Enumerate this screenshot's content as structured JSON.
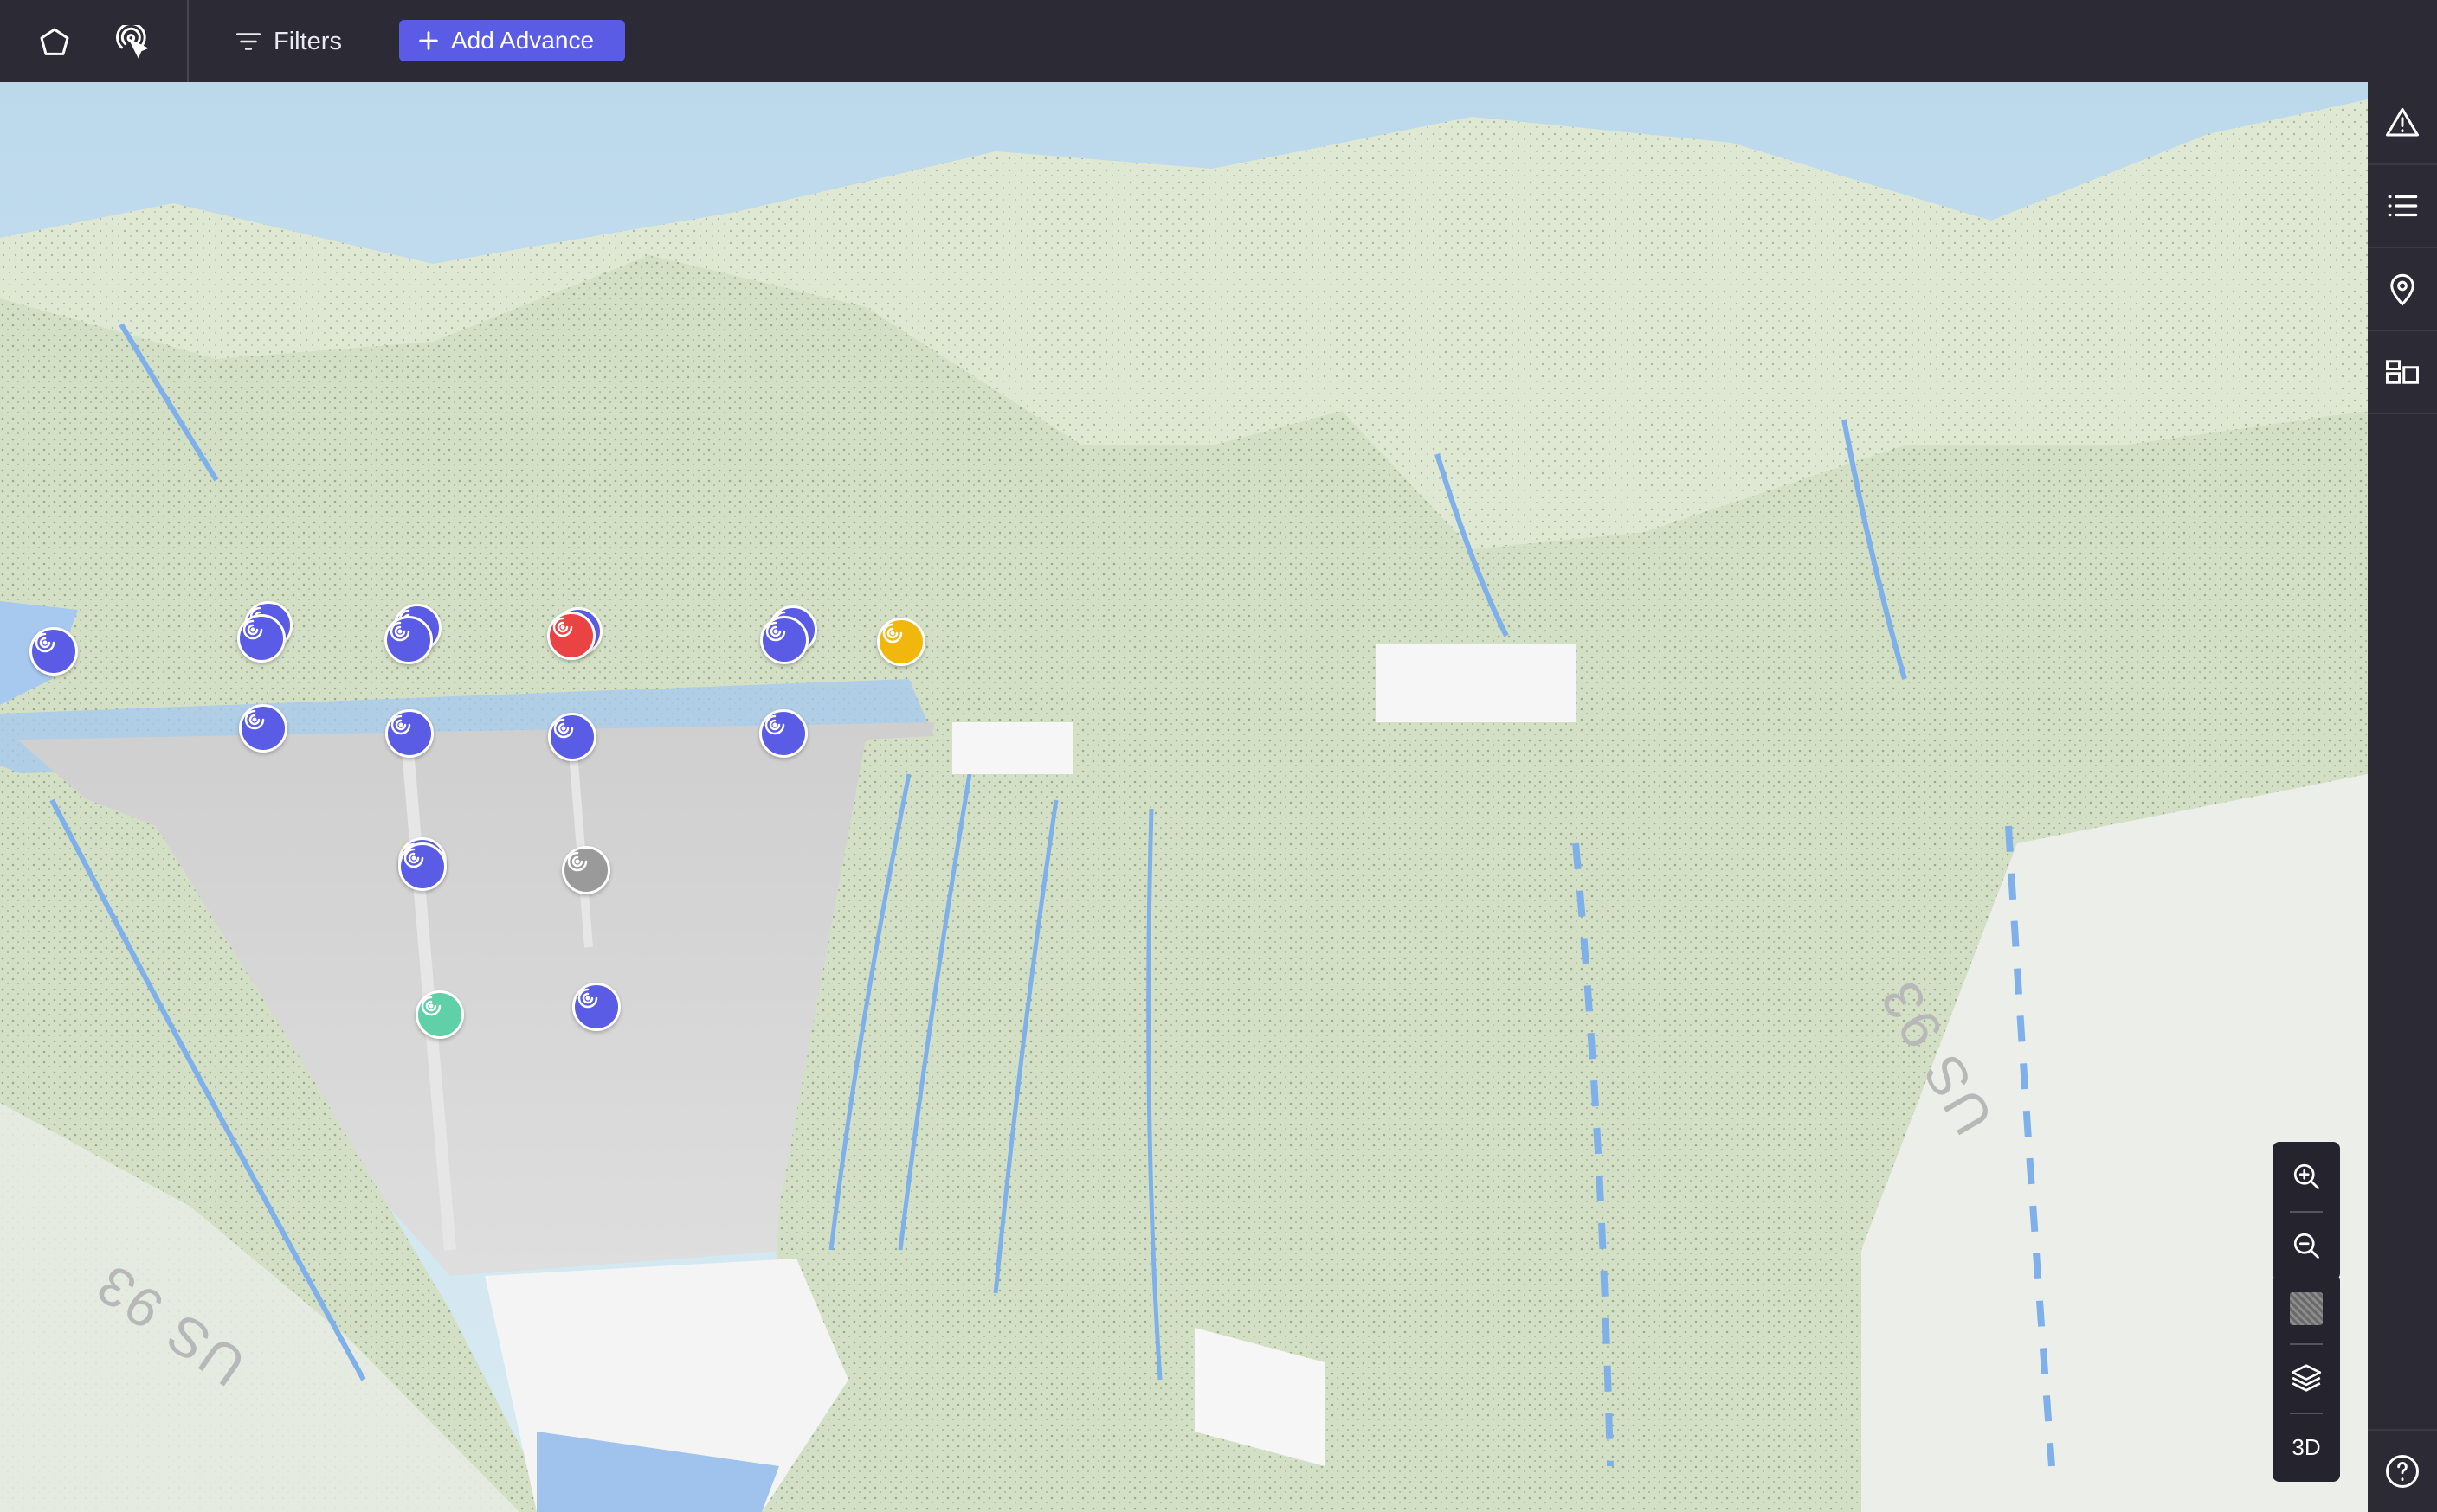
{
  "toolbar": {
    "polygon_tool": "polygon-tool",
    "pointer_tool": "pointer-tool",
    "filters_label": "Filters",
    "add_label": "Add Advance"
  },
  "rail": {
    "items": [
      "alert-icon",
      "list-icon",
      "location-pin-icon",
      "layout-icon"
    ],
    "help": "help-icon"
  },
  "controls": {
    "zoom_in": "zoom-in-icon",
    "zoom_out": "zoom-out-icon",
    "basemap": "basemap-thumbnail",
    "layers": "layers-icon",
    "mode_label": "3D"
  },
  "map": {
    "road_labels": [
      "US 93",
      "US 93"
    ],
    "marker_colors": {
      "default": "#5b5ce6",
      "alert": "#e94343",
      "warning": "#f2b70c",
      "inactive": "#9a9a9a",
      "ok": "#5fd0a8"
    },
    "markers": [
      {
        "status": "default"
      },
      {
        "status": "default"
      },
      {
        "status": "default"
      },
      {
        "status": "default"
      },
      {
        "status": "default"
      },
      {
        "status": "default"
      },
      {
        "status": "alert"
      },
      {
        "status": "default"
      },
      {
        "status": "default"
      },
      {
        "status": "warning"
      },
      {
        "status": "default"
      },
      {
        "status": "default"
      },
      {
        "status": "default"
      },
      {
        "status": "default"
      },
      {
        "status": "default"
      },
      {
        "status": "inactive"
      },
      {
        "status": "default"
      },
      {
        "status": "ok"
      },
      {
        "status": "default"
      }
    ]
  }
}
